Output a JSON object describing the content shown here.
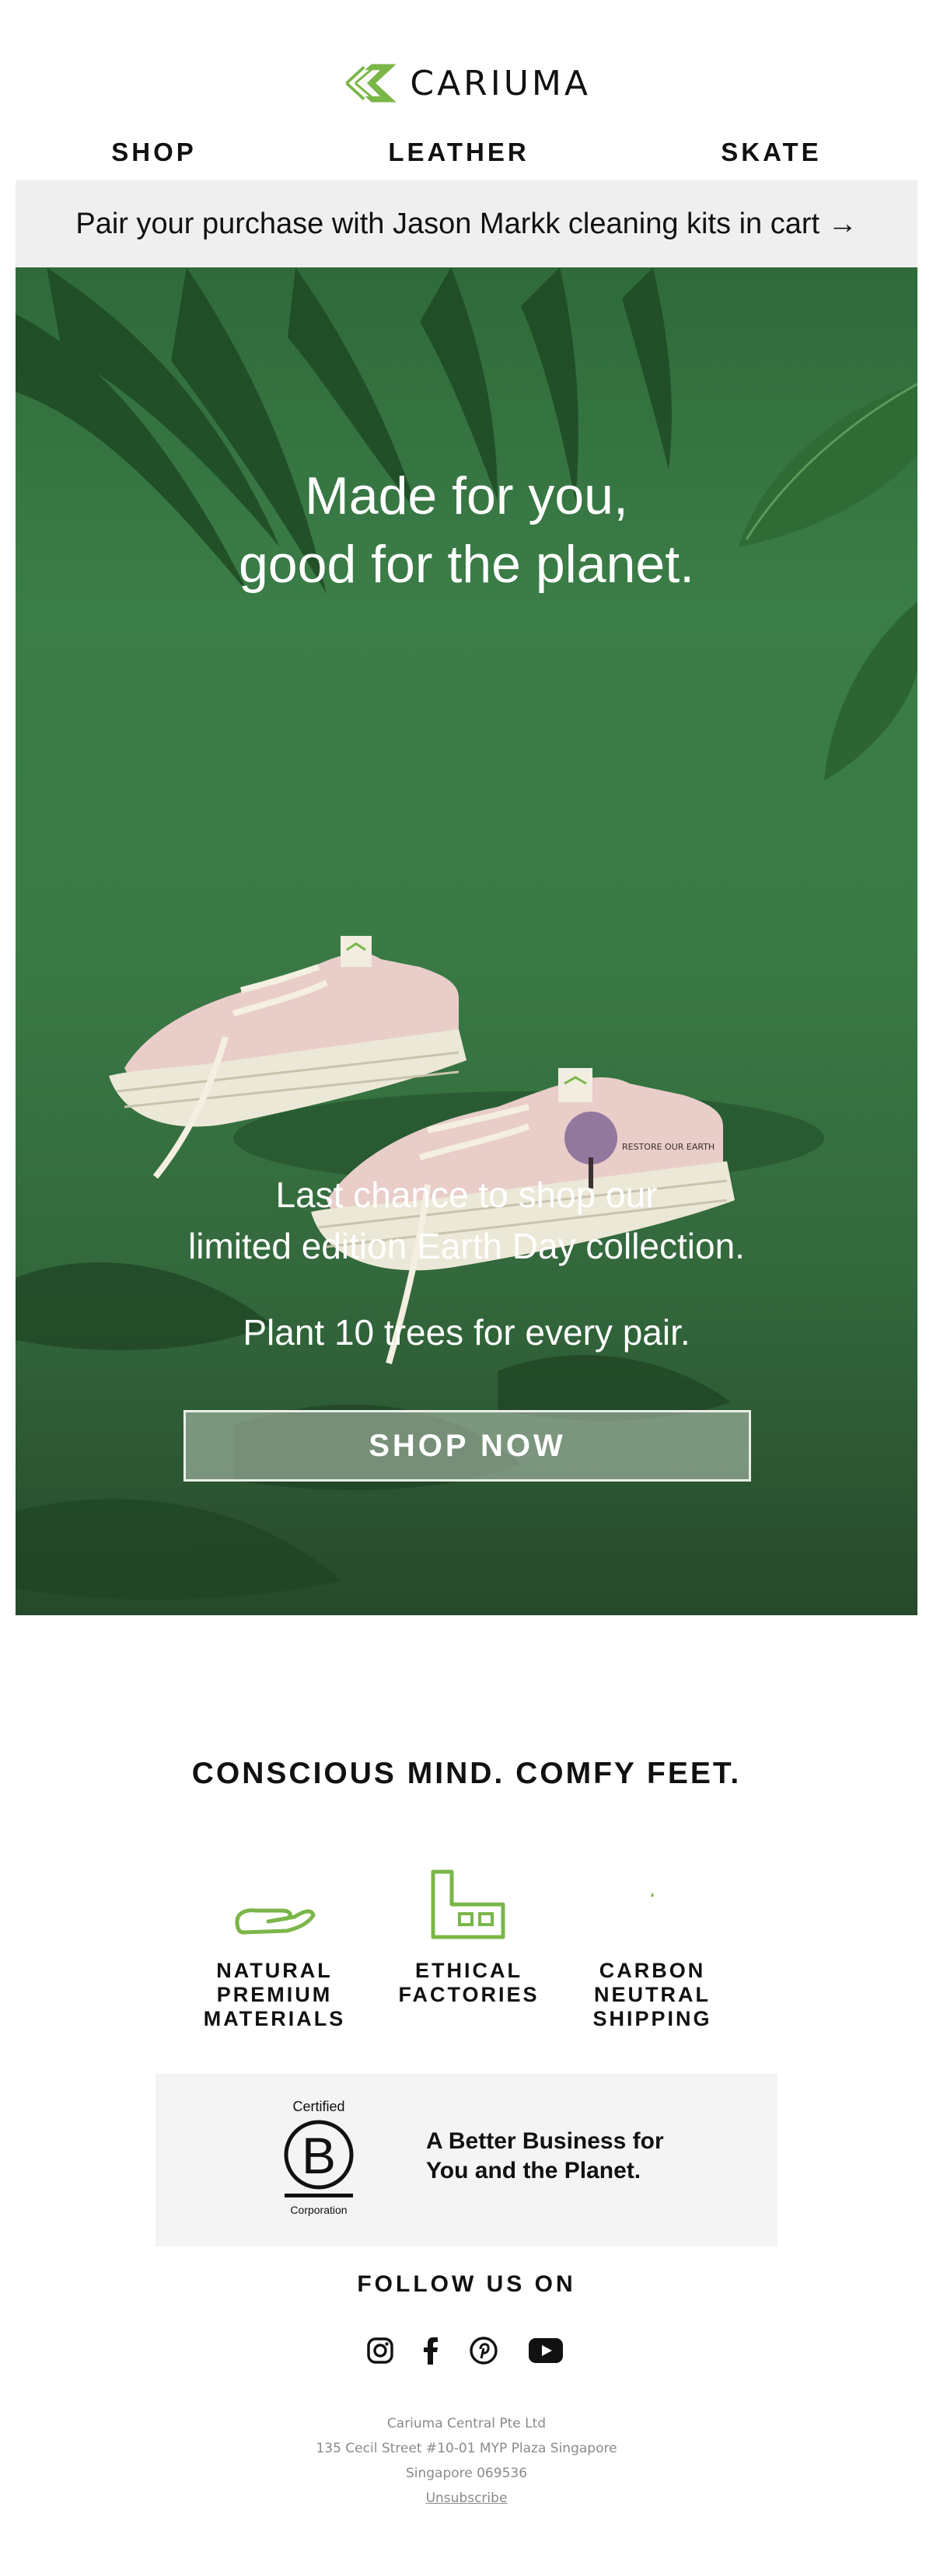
{
  "brand": {
    "name": "CARIUMA",
    "accent_color": "#7ab648",
    "logo_icon": "leaf-chevron-logo"
  },
  "nav": {
    "items": [
      {
        "label": "SHOP"
      },
      {
        "label": "LEATHER"
      },
      {
        "label": "SKATE"
      }
    ]
  },
  "promo": {
    "text": "Pair your purchase with Jason Markk cleaning kits in cart →"
  },
  "hero": {
    "headline_line1": "Made for you,",
    "headline_line2": "good for the planet.",
    "sub_line1": "Last chance to shop our",
    "sub_line2": "limited edition Earth Day collection.",
    "plant_text": "Plant 10 trees for every pair.",
    "cta_label": "SHOP NOW",
    "shoe_print_text": "RESTORE OUR EARTH",
    "background_color": "#3a7a45"
  },
  "conscious": {
    "title": "CONSCIOUS MIND. COMFY FEET.",
    "features": [
      {
        "icon": "hand-leaf-icon",
        "line1": "NATURAL",
        "line2": "PREMIUM",
        "line3": "MATERIALS"
      },
      {
        "icon": "factory-icon",
        "line1": "ETHICAL",
        "line2": "FACTORIES",
        "line3": ""
      },
      {
        "icon": "carbon-neutral-icon",
        "line1": "CARBON",
        "line2": "NEUTRAL",
        "line3": "SHIPPING"
      }
    ]
  },
  "bcorp": {
    "badge_top": "Certified",
    "badge_letter": "B",
    "badge_bottom": "Corporation",
    "text_line1": "A Better Business for",
    "text_line2": "You and the Planet."
  },
  "follow": {
    "title": "FOLLOW US ON",
    "icons": [
      "instagram-icon",
      "facebook-icon",
      "pinterest-icon",
      "youtube-icon"
    ]
  },
  "footer": {
    "company": "Cariuma Central Pte Ltd",
    "address1": "135 Cecil Street #10-01 MYP Plaza Singapore",
    "address2": "Singapore 069536",
    "unsubscribe": "Unsubscribe"
  }
}
